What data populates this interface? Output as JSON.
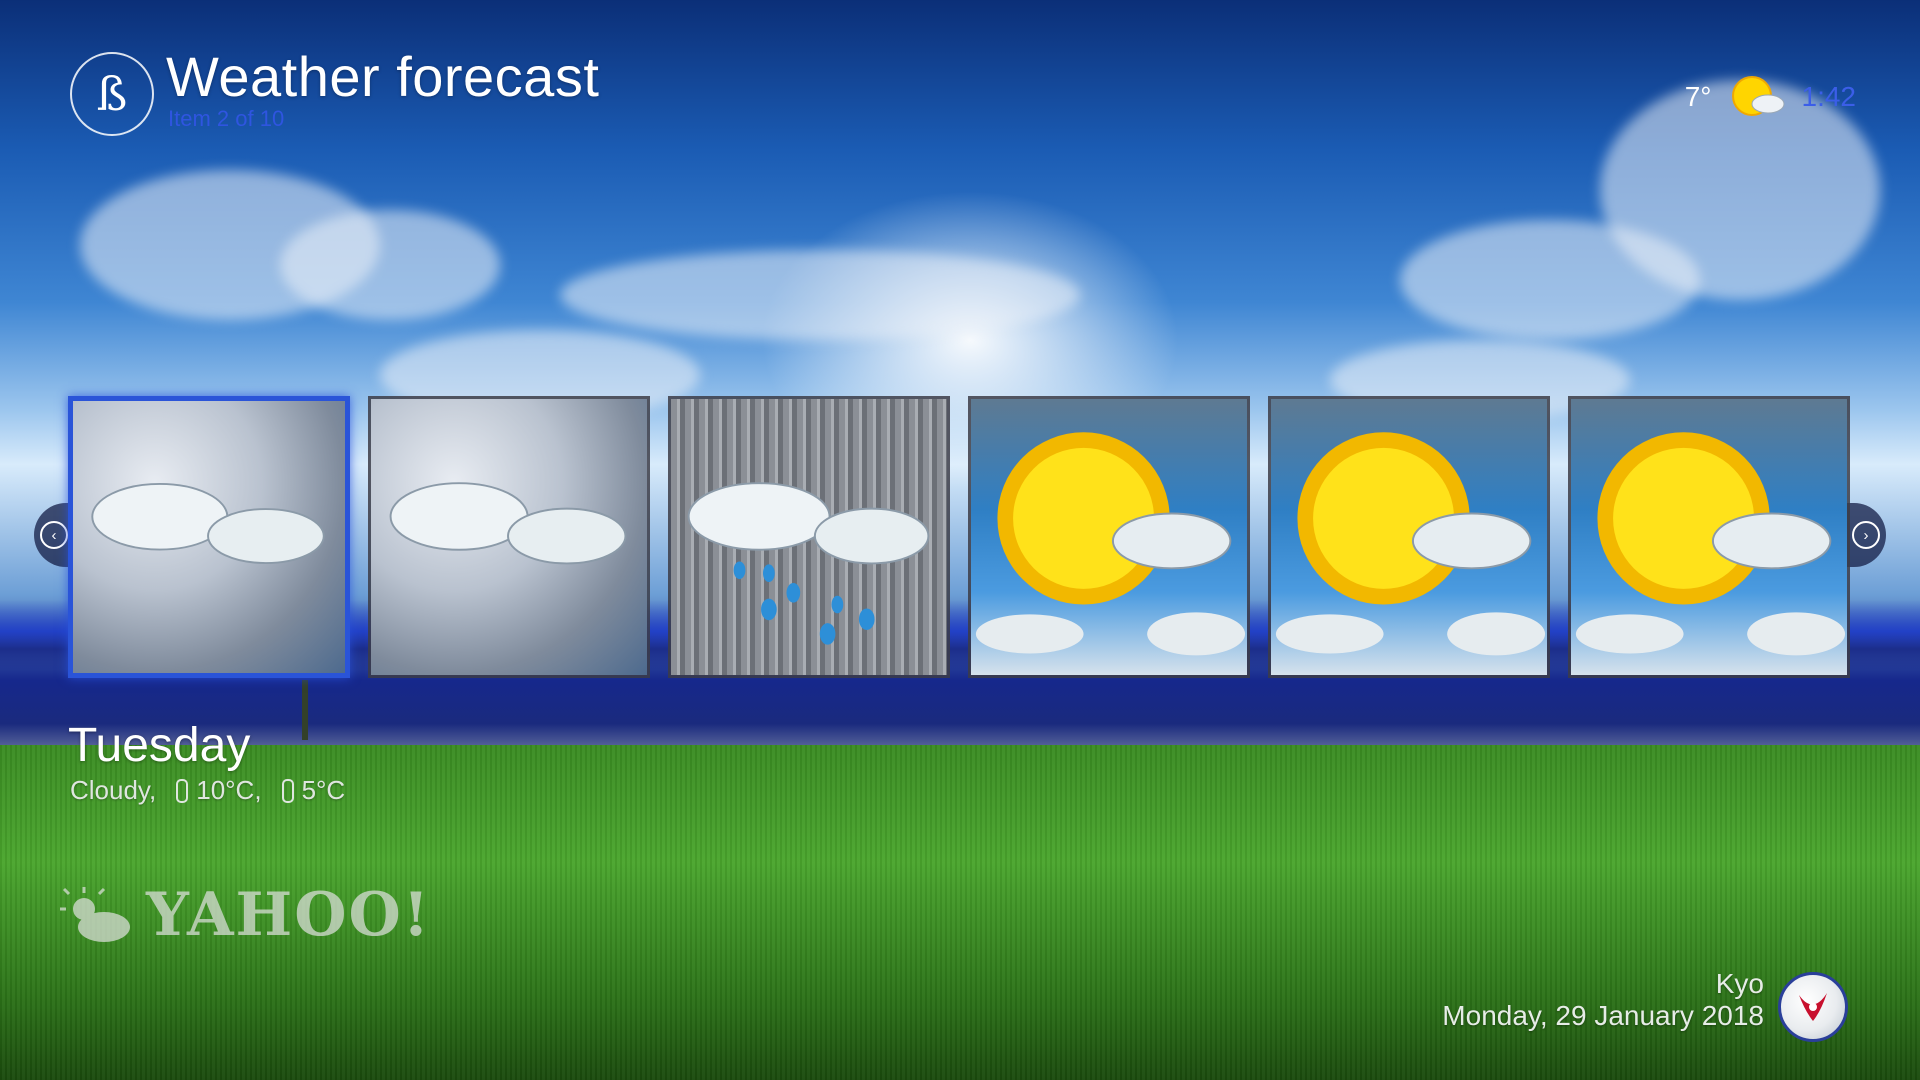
{
  "header": {
    "title": "Weather forecast",
    "subtitle": "Item 2 of 10",
    "logo_glyph": "ß"
  },
  "status": {
    "temperature": "7°",
    "time": "1:42",
    "weather_icon": "partly-sunny-icon"
  },
  "forecast": {
    "tiles": [
      {
        "condition": "cloudy",
        "icon": "cloudy-icon",
        "selected": true
      },
      {
        "condition": "cloudy",
        "icon": "cloudy-icon",
        "selected": false
      },
      {
        "condition": "rain",
        "icon": "rain-icon",
        "selected": false
      },
      {
        "condition": "partly-sunny",
        "icon": "partly-sunny-icon",
        "selected": false
      },
      {
        "condition": "partly-sunny",
        "icon": "partly-sunny-icon",
        "selected": false
      },
      {
        "condition": "partly-sunny",
        "icon": "partly-sunny-icon",
        "selected": false
      }
    ],
    "selected": {
      "day": "Tuesday",
      "condition_text": "Cloudy,",
      "high": "10°C,",
      "low": "5°C"
    }
  },
  "provider": {
    "name": "YAHOO!",
    "icon": "sun-cloud-icon"
  },
  "footer": {
    "user": "Kyo",
    "date": "Monday, 29 January 2018"
  },
  "colors": {
    "accent": "#2a54d8",
    "clock": "#3b5ee8"
  }
}
